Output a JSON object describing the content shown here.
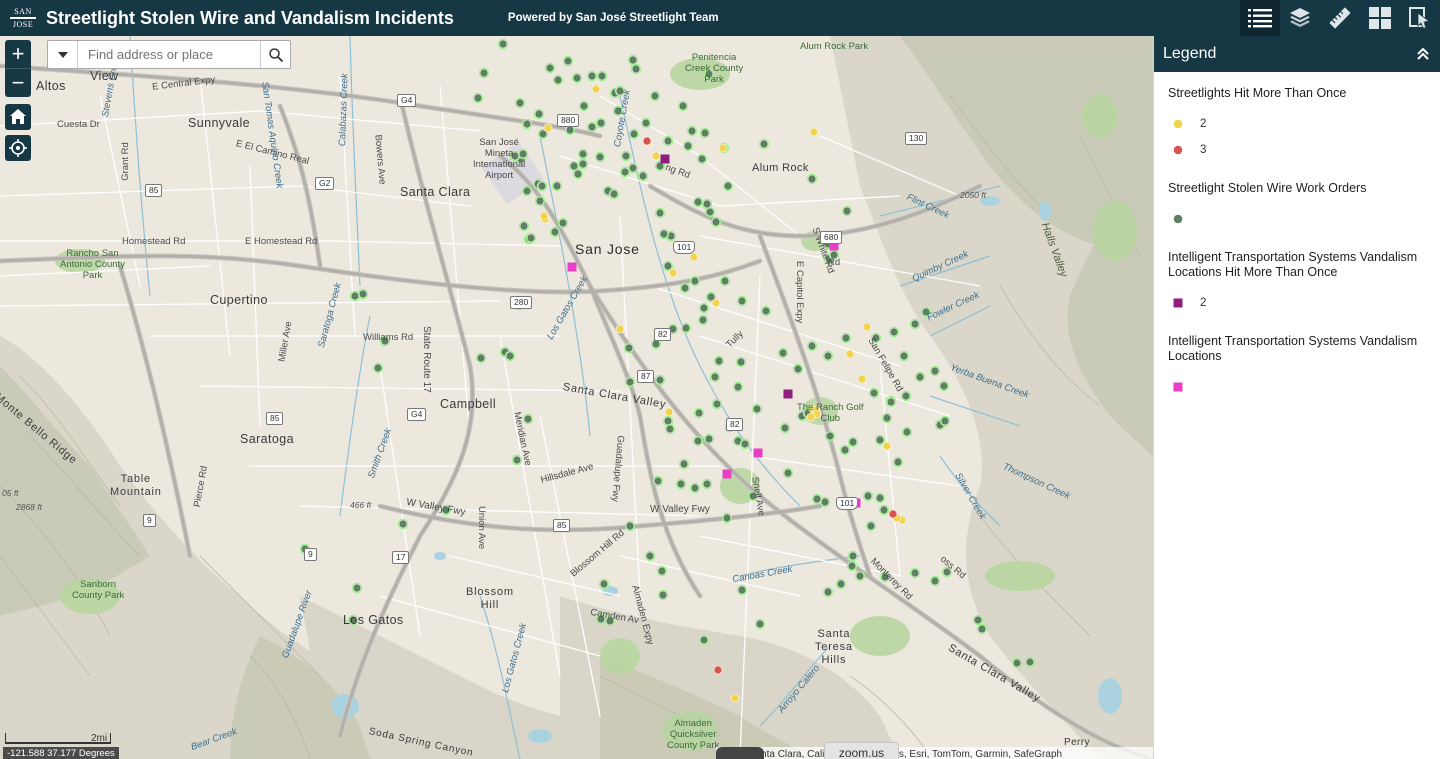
{
  "header": {
    "logo_line1": "SAN",
    "logo_line2": "JOSE",
    "title": "Streetlight Stolen Wire and Vandalism Incidents",
    "subtitle": "Powered by San José Streetlight Team",
    "tools": [
      "legend-icon",
      "layers-icon",
      "measure-icon",
      "basemap-gallery-icon",
      "select-icon"
    ]
  },
  "search": {
    "placeholder": "Find address or place"
  },
  "map_controls": {
    "zoom_in": "+",
    "zoom_out": "−"
  },
  "map_labels": {
    "cities": {
      "altos": "Altos",
      "view": "View",
      "sunnyvale": "Sunnyvale",
      "santa_clara": "Santa Clara",
      "san_jose": "San Jose",
      "alum_rock": "Alum Rock",
      "cupertino": "Cupertino",
      "campbell": "Campbell",
      "saratoga": "Saratoga",
      "los_gatos": "Los Gatos",
      "perry": "Perry"
    },
    "terrain": {
      "monte_bello_ridge": "Monte Bello Ridge",
      "table_mountain": "Table\nMountain",
      "blossom_hill": "Blossom\nHill",
      "santa_teresa_hills": "Santa\nTeresa\nHills",
      "santa_clara_valley": "Santa Clara Valley",
      "santa_clara_valley_se": "Santa Clara Valley",
      "soda_spring_canyon": "Soda Spring Canyon"
    },
    "parks": {
      "penitencia": "Penitencia\nCreek County\nPark",
      "rancho": "Rancho San\nAntonio County\nPark",
      "sanborn": "Sanborn\nCounty Park",
      "almaden": "Almaden\nQuicksilver\nCounty Park",
      "golf": "The Ranch Golf\nClub",
      "airport": "San José\nMineta\nInternational\nAirport",
      "alum_rock_park": "Alum Rock Park"
    },
    "roads": {
      "central_expy": "E Central Expy",
      "cuesta": "Cuesta Dr",
      "el_camino": "E El Camino Real",
      "grant": "Grant Rd",
      "homestead": "Homestead Rd",
      "e_homestead": "E Homestead Rd",
      "bowers": "Bowers Ave",
      "stevens_blvd": "Stevens Creek Blvd",
      "sr17": "State Route 17",
      "miller": "Miller Ave",
      "williams": "Williams Rd",
      "meridian": "Meridian Ave",
      "hillsdale": "Hillsdale Ave",
      "guadalupe": "Guadalupe Fwy",
      "union": "Union Ave",
      "w_valley": "W Valley Fwy",
      "w_valley2": "W Valley Fwy",
      "blossom_hill_rd": "Blossom Hill Rd",
      "almaden_expy": "Almaden Expy",
      "camden": "Camden Av",
      "snell": "Snell Ave",
      "monterey": "Monterey Rd",
      "capitol": "E Capitol Expy",
      "tully": "Tully",
      "s_white": "S White Rd",
      "san_felipe": "San Felipe Rd",
      "pierce": "Pierce Rd",
      "ng_rd": "ng Rd",
      "cross_rd": "oss Rd",
      "alum_rd": "Rd",
      "white_rd": "Rd"
    },
    "water": {
      "stevens_creek": "Stevens Creek",
      "calabazas": "Calabazas Creek",
      "san_tomas": "San Tomas Aquino Creek",
      "saratoga_creek": "Saratoga Creek",
      "los_gatos_creek": "Los Gatos Creek",
      "guadalupe_r": "Guadalupe River",
      "coyote_creek": "Coyote Creek",
      "flint_creek": "Flint Creek",
      "quimby_creek": "Quimby Creek",
      "fowler_creek": "Fowler Creek",
      "yerba_buena": "Yerba Buena Creek",
      "silver_creek": "Silver Creek",
      "thompson": "Thompson Creek",
      "canoas": "Canoas Creek",
      "halls_valley": "Halls Valley",
      "smith_creek": "Smith Creek",
      "arroyo": "Arroyo Calero",
      "bear_creek": "Bear Creek",
      "san_jose_creek": "Los Gatos Creek"
    },
    "elevations": {
      "e2050": "2050 ft",
      "e2868": "2868 ft",
      "e466": "466 ft",
      "e05": "05 ft"
    },
    "shields": {
      "i880": "880",
      "i680": "680",
      "us101": "101",
      "us101b": "101",
      "i280": "280",
      "g4": "G4",
      "g4b": "G4",
      "g2": "G2",
      "s85": "85",
      "s85b": "85",
      "s82": "82",
      "s82b": "82",
      "s130": "130",
      "s87": "87",
      "s17": "17",
      "s9": "9",
      "s9b": "9"
    }
  },
  "scale": {
    "label": "2mi"
  },
  "coordinates": "-121.588 37.177 Degrees",
  "attribution": "unty of Santa Clara, California State Parks, Esri, TomTom, Garmin, SafeGraph",
  "zoom_us_tab": "zoom.us",
  "legend": {
    "title": "Legend",
    "sections": [
      {
        "title": "Streetlights Hit More Than Once",
        "items": [
          {
            "label": "2",
            "symbol": "circle",
            "color": "#f2d34e"
          },
          {
            "label": "3",
            "symbol": "circle",
            "color": "#d9534f"
          }
        ]
      },
      {
        "title": "Streetlight Stolen Wire Work Orders",
        "items": [
          {
            "label": "",
            "symbol": "circle",
            "color": "#5e8060"
          }
        ]
      },
      {
        "title": "Intelligent Transportation Systems Vandalism Locations Hit More Than Once",
        "items": [
          {
            "label": "2",
            "symbol": "square",
            "color": "#8e1f7c"
          }
        ]
      },
      {
        "title": "Intelligent Transportation Systems Vandalism Locations",
        "items": [
          {
            "label": "",
            "symbol": "square",
            "color": "#e83fc6"
          }
        ]
      }
    ]
  },
  "colors": {
    "header_bg": "#163845",
    "streetlight_stolen_wire": "#5e8060",
    "streetlight_stolen_wire_halo": "#8ef07a",
    "hit_twice": "#f2d34e",
    "hit_three": "#d9534f",
    "its_hit_twice": "#8e1f7c",
    "its_location": "#e83fc6"
  }
}
